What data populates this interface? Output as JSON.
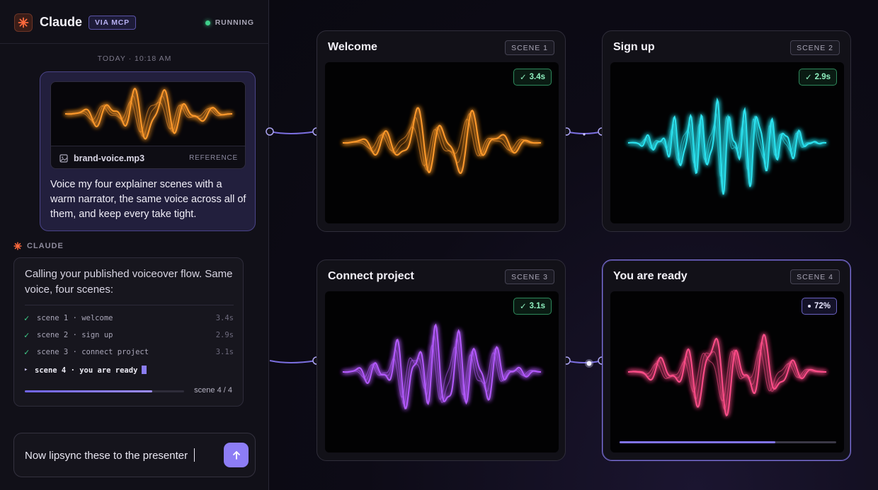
{
  "header": {
    "app_title": "Claude",
    "badge": "VIA MCP",
    "status": "RUNNING",
    "logo_icon": "claude-spark-icon"
  },
  "chat": {
    "timestamp": "TODAY · 10:18 AM",
    "user_message": {
      "attachment": {
        "file_name": "brand-voice.mp3",
        "tag": "REFERENCE",
        "icon": "image-file-icon",
        "wave_color": "#ff9a2e"
      },
      "text": "Voice my four explainer scenes with a warm narrator, the same voice across all of them, and keep every take tight."
    },
    "assistant": {
      "label": "CLAUDE",
      "intro": "Calling your published voiceover flow. Same voice, four scenes:",
      "scenes": [
        {
          "label": "scene 1 · welcome",
          "duration": "3.4s",
          "status": "done"
        },
        {
          "label": "scene 2 · sign up",
          "duration": "2.9s",
          "status": "done"
        },
        {
          "label": "scene 3 · connect project",
          "duration": "3.1s",
          "status": "done"
        },
        {
          "label": "scene 4 · you are ready",
          "duration": "",
          "status": "running"
        }
      ],
      "progress_fraction": 0.8,
      "progress_text": "scene 4 / 4"
    },
    "composer": {
      "value": "Now lipsync these to the presenter",
      "send_icon": "arrow-up-icon"
    }
  },
  "canvas": {
    "scenes": [
      {
        "title": "Welcome",
        "tag": "SCENE 1",
        "chip": "3.4s",
        "status": "done",
        "color": "#ff9a2e"
      },
      {
        "title": "Sign up",
        "tag": "SCENE 2",
        "chip": "2.9s",
        "status": "done",
        "color": "#2fe3f0"
      },
      {
        "title": "Connect project",
        "tag": "SCENE 3",
        "chip": "3.1s",
        "status": "done",
        "color": "#b55cff"
      },
      {
        "title": "You are ready",
        "tag": "SCENE 4",
        "chip": "72%",
        "status": "running",
        "progress_fraction": 0.72,
        "color": "#ff4f8a"
      }
    ],
    "check_glyph": "✓",
    "connector_color": "#7b6fe0"
  }
}
